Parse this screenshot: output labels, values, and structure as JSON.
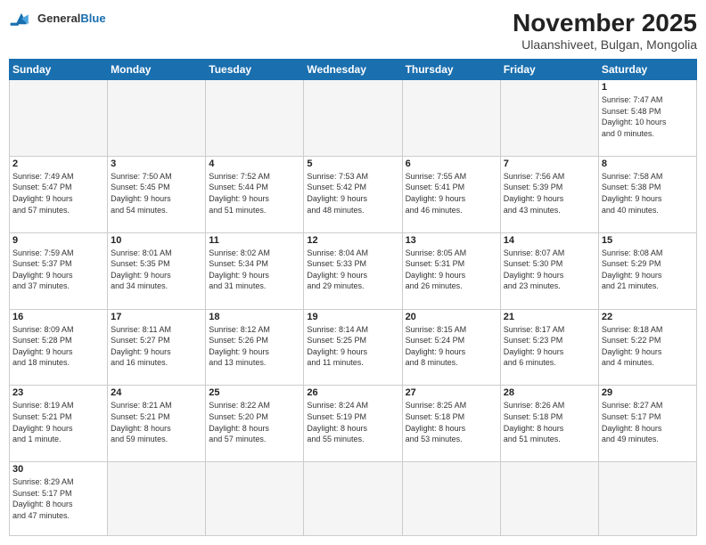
{
  "header": {
    "logo_general": "General",
    "logo_blue": "Blue",
    "month_title": "November 2025",
    "subtitle": "Ulaanshiveet, Bulgan, Mongolia"
  },
  "weekdays": [
    "Sunday",
    "Monday",
    "Tuesday",
    "Wednesday",
    "Thursday",
    "Friday",
    "Saturday"
  ],
  "weeks": [
    [
      {
        "day": "",
        "info": ""
      },
      {
        "day": "",
        "info": ""
      },
      {
        "day": "",
        "info": ""
      },
      {
        "day": "",
        "info": ""
      },
      {
        "day": "",
        "info": ""
      },
      {
        "day": "",
        "info": ""
      },
      {
        "day": "1",
        "info": "Sunrise: 7:47 AM\nSunset: 5:48 PM\nDaylight: 10 hours\nand 0 minutes."
      }
    ],
    [
      {
        "day": "2",
        "info": "Sunrise: 7:49 AM\nSunset: 5:47 PM\nDaylight: 9 hours\nand 57 minutes."
      },
      {
        "day": "3",
        "info": "Sunrise: 7:50 AM\nSunset: 5:45 PM\nDaylight: 9 hours\nand 54 minutes."
      },
      {
        "day": "4",
        "info": "Sunrise: 7:52 AM\nSunset: 5:44 PM\nDaylight: 9 hours\nand 51 minutes."
      },
      {
        "day": "5",
        "info": "Sunrise: 7:53 AM\nSunset: 5:42 PM\nDaylight: 9 hours\nand 48 minutes."
      },
      {
        "day": "6",
        "info": "Sunrise: 7:55 AM\nSunset: 5:41 PM\nDaylight: 9 hours\nand 46 minutes."
      },
      {
        "day": "7",
        "info": "Sunrise: 7:56 AM\nSunset: 5:39 PM\nDaylight: 9 hours\nand 43 minutes."
      },
      {
        "day": "8",
        "info": "Sunrise: 7:58 AM\nSunset: 5:38 PM\nDaylight: 9 hours\nand 40 minutes."
      }
    ],
    [
      {
        "day": "9",
        "info": "Sunrise: 7:59 AM\nSunset: 5:37 PM\nDaylight: 9 hours\nand 37 minutes."
      },
      {
        "day": "10",
        "info": "Sunrise: 8:01 AM\nSunset: 5:35 PM\nDaylight: 9 hours\nand 34 minutes."
      },
      {
        "day": "11",
        "info": "Sunrise: 8:02 AM\nSunset: 5:34 PM\nDaylight: 9 hours\nand 31 minutes."
      },
      {
        "day": "12",
        "info": "Sunrise: 8:04 AM\nSunset: 5:33 PM\nDaylight: 9 hours\nand 29 minutes."
      },
      {
        "day": "13",
        "info": "Sunrise: 8:05 AM\nSunset: 5:31 PM\nDaylight: 9 hours\nand 26 minutes."
      },
      {
        "day": "14",
        "info": "Sunrise: 8:07 AM\nSunset: 5:30 PM\nDaylight: 9 hours\nand 23 minutes."
      },
      {
        "day": "15",
        "info": "Sunrise: 8:08 AM\nSunset: 5:29 PM\nDaylight: 9 hours\nand 21 minutes."
      }
    ],
    [
      {
        "day": "16",
        "info": "Sunrise: 8:09 AM\nSunset: 5:28 PM\nDaylight: 9 hours\nand 18 minutes."
      },
      {
        "day": "17",
        "info": "Sunrise: 8:11 AM\nSunset: 5:27 PM\nDaylight: 9 hours\nand 16 minutes."
      },
      {
        "day": "18",
        "info": "Sunrise: 8:12 AM\nSunset: 5:26 PM\nDaylight: 9 hours\nand 13 minutes."
      },
      {
        "day": "19",
        "info": "Sunrise: 8:14 AM\nSunset: 5:25 PM\nDaylight: 9 hours\nand 11 minutes."
      },
      {
        "day": "20",
        "info": "Sunrise: 8:15 AM\nSunset: 5:24 PM\nDaylight: 9 hours\nand 8 minutes."
      },
      {
        "day": "21",
        "info": "Sunrise: 8:17 AM\nSunset: 5:23 PM\nDaylight: 9 hours\nand 6 minutes."
      },
      {
        "day": "22",
        "info": "Sunrise: 8:18 AM\nSunset: 5:22 PM\nDaylight: 9 hours\nand 4 minutes."
      }
    ],
    [
      {
        "day": "23",
        "info": "Sunrise: 8:19 AM\nSunset: 5:21 PM\nDaylight: 9 hours\nand 1 minute."
      },
      {
        "day": "24",
        "info": "Sunrise: 8:21 AM\nSunset: 5:21 PM\nDaylight: 8 hours\nand 59 minutes."
      },
      {
        "day": "25",
        "info": "Sunrise: 8:22 AM\nSunset: 5:20 PM\nDaylight: 8 hours\nand 57 minutes."
      },
      {
        "day": "26",
        "info": "Sunrise: 8:24 AM\nSunset: 5:19 PM\nDaylight: 8 hours\nand 55 minutes."
      },
      {
        "day": "27",
        "info": "Sunrise: 8:25 AM\nSunset: 5:18 PM\nDaylight: 8 hours\nand 53 minutes."
      },
      {
        "day": "28",
        "info": "Sunrise: 8:26 AM\nSunset: 5:18 PM\nDaylight: 8 hours\nand 51 minutes."
      },
      {
        "day": "29",
        "info": "Sunrise: 8:27 AM\nSunset: 5:17 PM\nDaylight: 8 hours\nand 49 minutes."
      }
    ],
    [
      {
        "day": "30",
        "info": "Sunrise: 8:29 AM\nSunset: 5:17 PM\nDaylight: 8 hours\nand 47 minutes."
      },
      {
        "day": "",
        "info": ""
      },
      {
        "day": "",
        "info": ""
      },
      {
        "day": "",
        "info": ""
      },
      {
        "day": "",
        "info": ""
      },
      {
        "day": "",
        "info": ""
      },
      {
        "day": "",
        "info": ""
      }
    ]
  ]
}
